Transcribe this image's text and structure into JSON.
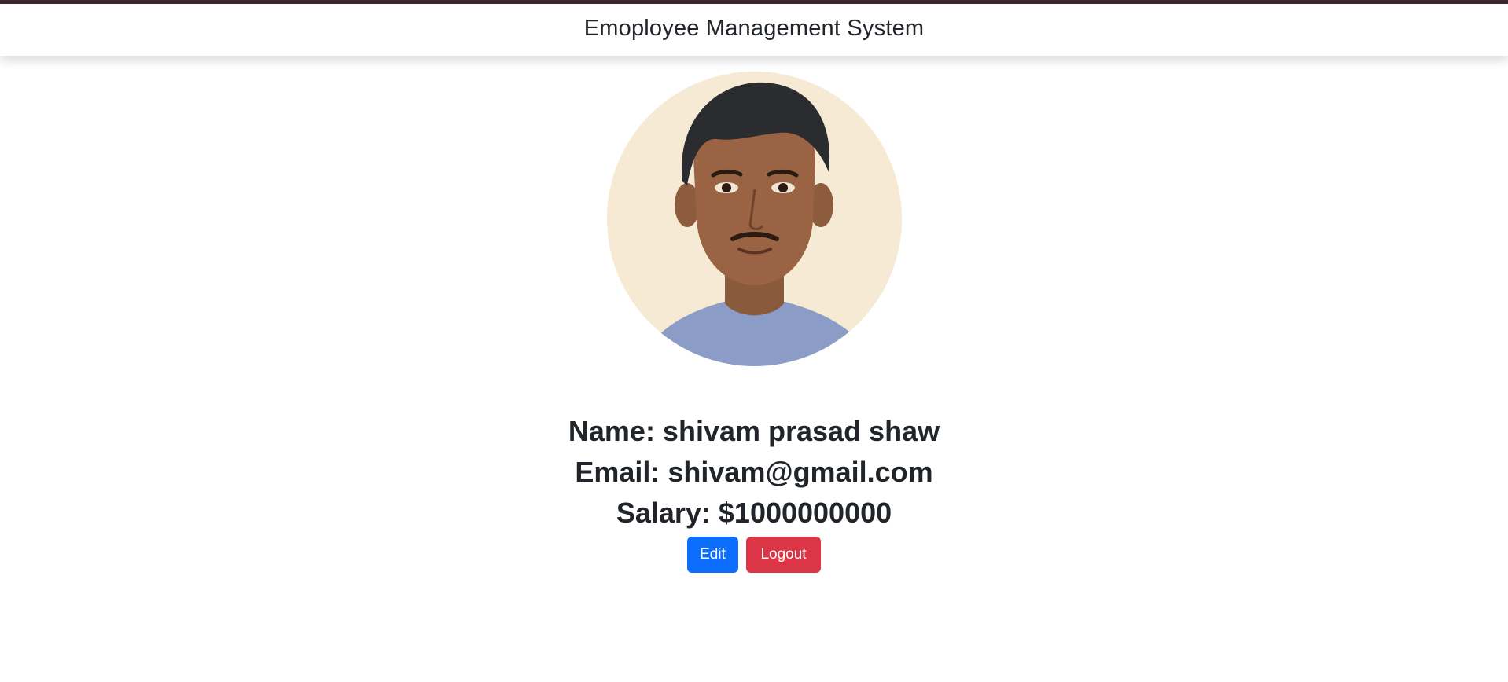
{
  "header": {
    "title": "Emoployee Management System"
  },
  "profile": {
    "photo_alt": "profile photo",
    "name_line": "Name: shivam prasad shaw",
    "email_line": "Email: shivam@gmail.com",
    "salary_line": "Salary: $1000000000"
  },
  "actions": {
    "edit_label": "Edit",
    "logout_label": "Logout"
  },
  "colors": {
    "top_border": "#3e2b2e",
    "edit_button": "#0d6efd",
    "logout_button": "#dc3545",
    "text": "#212529"
  }
}
